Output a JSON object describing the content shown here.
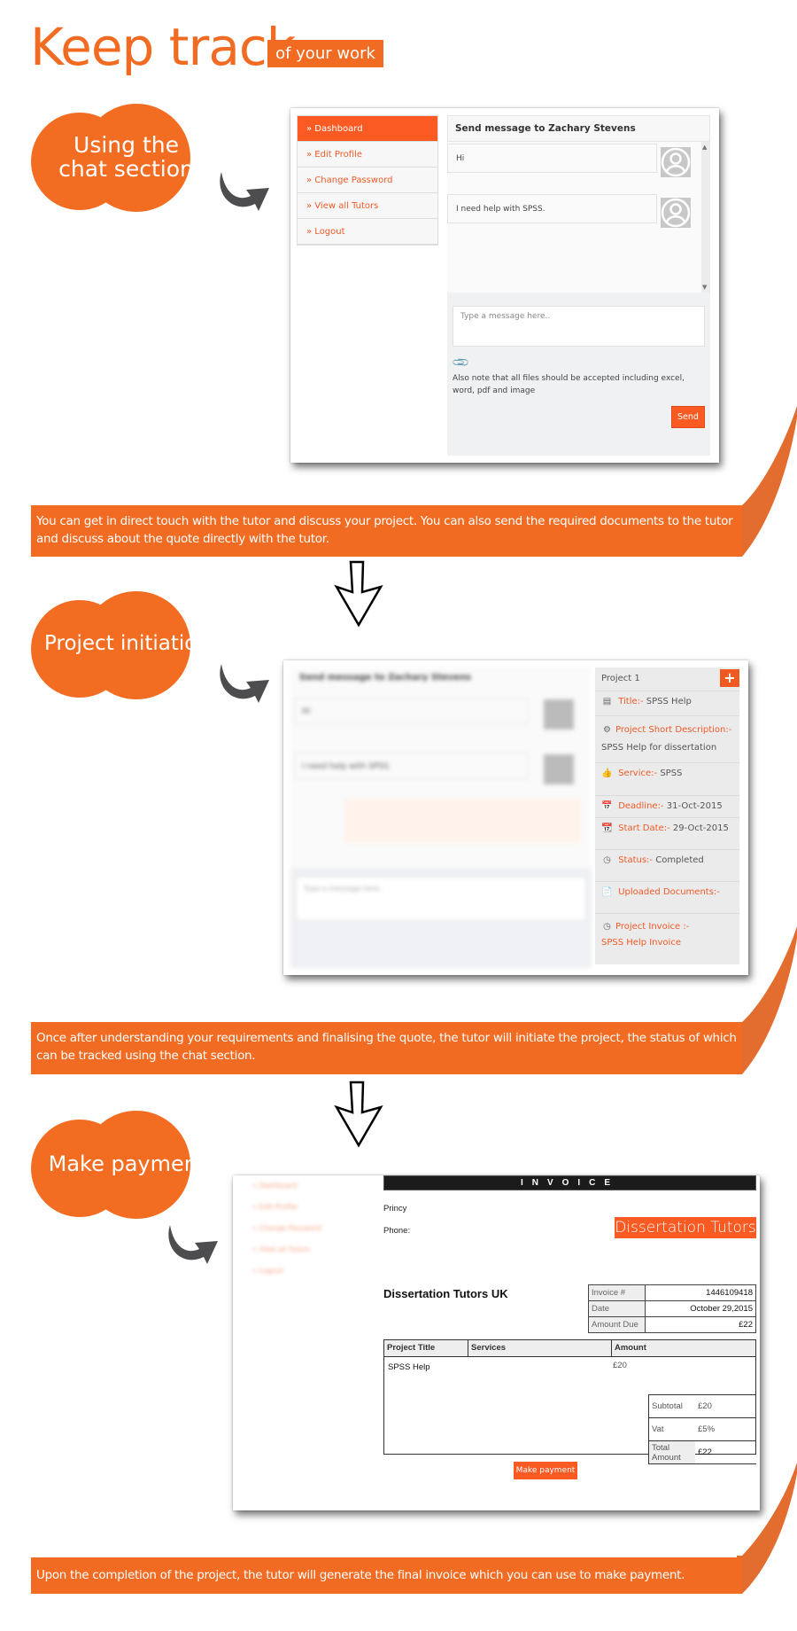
{
  "header": {
    "title": "Keep track",
    "badge": "of your work"
  },
  "colors": {
    "accent": "#f26b22",
    "button": "#fb5a23",
    "arrow_gray": "#4d4d4f"
  },
  "sections": [
    {
      "label_line1": "Using the",
      "label_line2": "chat section",
      "caption": "You can get in direct touch with the tutor and discuss your project. You can also send the required documents to the tutor and discuss about the quote directly with the tutor."
    },
    {
      "label": "Project initiation",
      "caption": "Once after understanding your requirements and finalising the quote, the tutor will initiate the project, the status of which can be tracked using the chat section."
    },
    {
      "label": "Make payment",
      "caption": "Upon the completion of the project, the tutor will generate the final invoice which you can use to make payment."
    }
  ],
  "sidebar": {
    "items": [
      {
        "label": "» Dashboard",
        "active": true
      },
      {
        "label": "» Edit Profile"
      },
      {
        "label": "» Change Password"
      },
      {
        "label": "» View all Tutors"
      },
      {
        "label": "» Logout"
      }
    ]
  },
  "chat": {
    "header": "Send message to Zachary Stevens",
    "messages": [
      {
        "text": "Hi"
      },
      {
        "text": "I need help with SPSS."
      }
    ],
    "input_placeholder": "Type a message here..",
    "note": "Also note that all files should be accepted including excel, word, pdf and image",
    "send_label": "Send",
    "scroll_up": "▲",
    "scroll_down": "▼",
    "attach_icon": "paperclip-icon"
  },
  "chat_blurred": {
    "header": "Send message to Zachary Stevens",
    "messages": [
      "Hi",
      "I need help with SPSS."
    ],
    "input_placeholder": "Type a message here.."
  },
  "project": {
    "header": "Project 1",
    "add_label": "+",
    "title_label": "Title:-",
    "title_value": "SPSS Help",
    "desc_label": "Project Short Description:-",
    "desc_value": "SPSS Help for dissertation",
    "service_label": "Service:-",
    "service_value": "SPSS",
    "deadline_label": "Deadline:-",
    "deadline_value": "31-Oct-2015",
    "start_label": "Start Date:-",
    "start_value": "29-Oct-2015",
    "status_label": "Status:-",
    "status_value": "Completed",
    "docs_label": "Uploaded Documents:-",
    "invoice_label": "Project Invoice :-",
    "invoice_link": "SPSS Help Invoice"
  },
  "invoice": {
    "bar_title": "INVOICE",
    "customer": "Princy",
    "phone_label": "Phone:",
    "logo": "Dissertation Tutors",
    "company": "Dissertation Tutors UK",
    "meta": [
      {
        "key": "Invoice #",
        "value": "1446109418"
      },
      {
        "key": "Date",
        "value": "October 29,2015"
      },
      {
        "key": "Amount Due",
        "value": "£22"
      }
    ],
    "columns": [
      "Project Title",
      "Services",
      "Amount"
    ],
    "items": [
      {
        "title": "SPSS Help",
        "services": "",
        "amount": "£20"
      }
    ],
    "totals": [
      {
        "key": "Subtotal",
        "value": "£20"
      },
      {
        "key": "Vat",
        "value": "£5%"
      },
      {
        "key": "Total Amount",
        "value": "£22"
      }
    ],
    "pay_label": "Make payment"
  },
  "blurred_sidebar": [
    "» Dashboard",
    "» Edit Profile",
    "» Change Password",
    "» View all Tutors",
    "» Logout"
  ]
}
